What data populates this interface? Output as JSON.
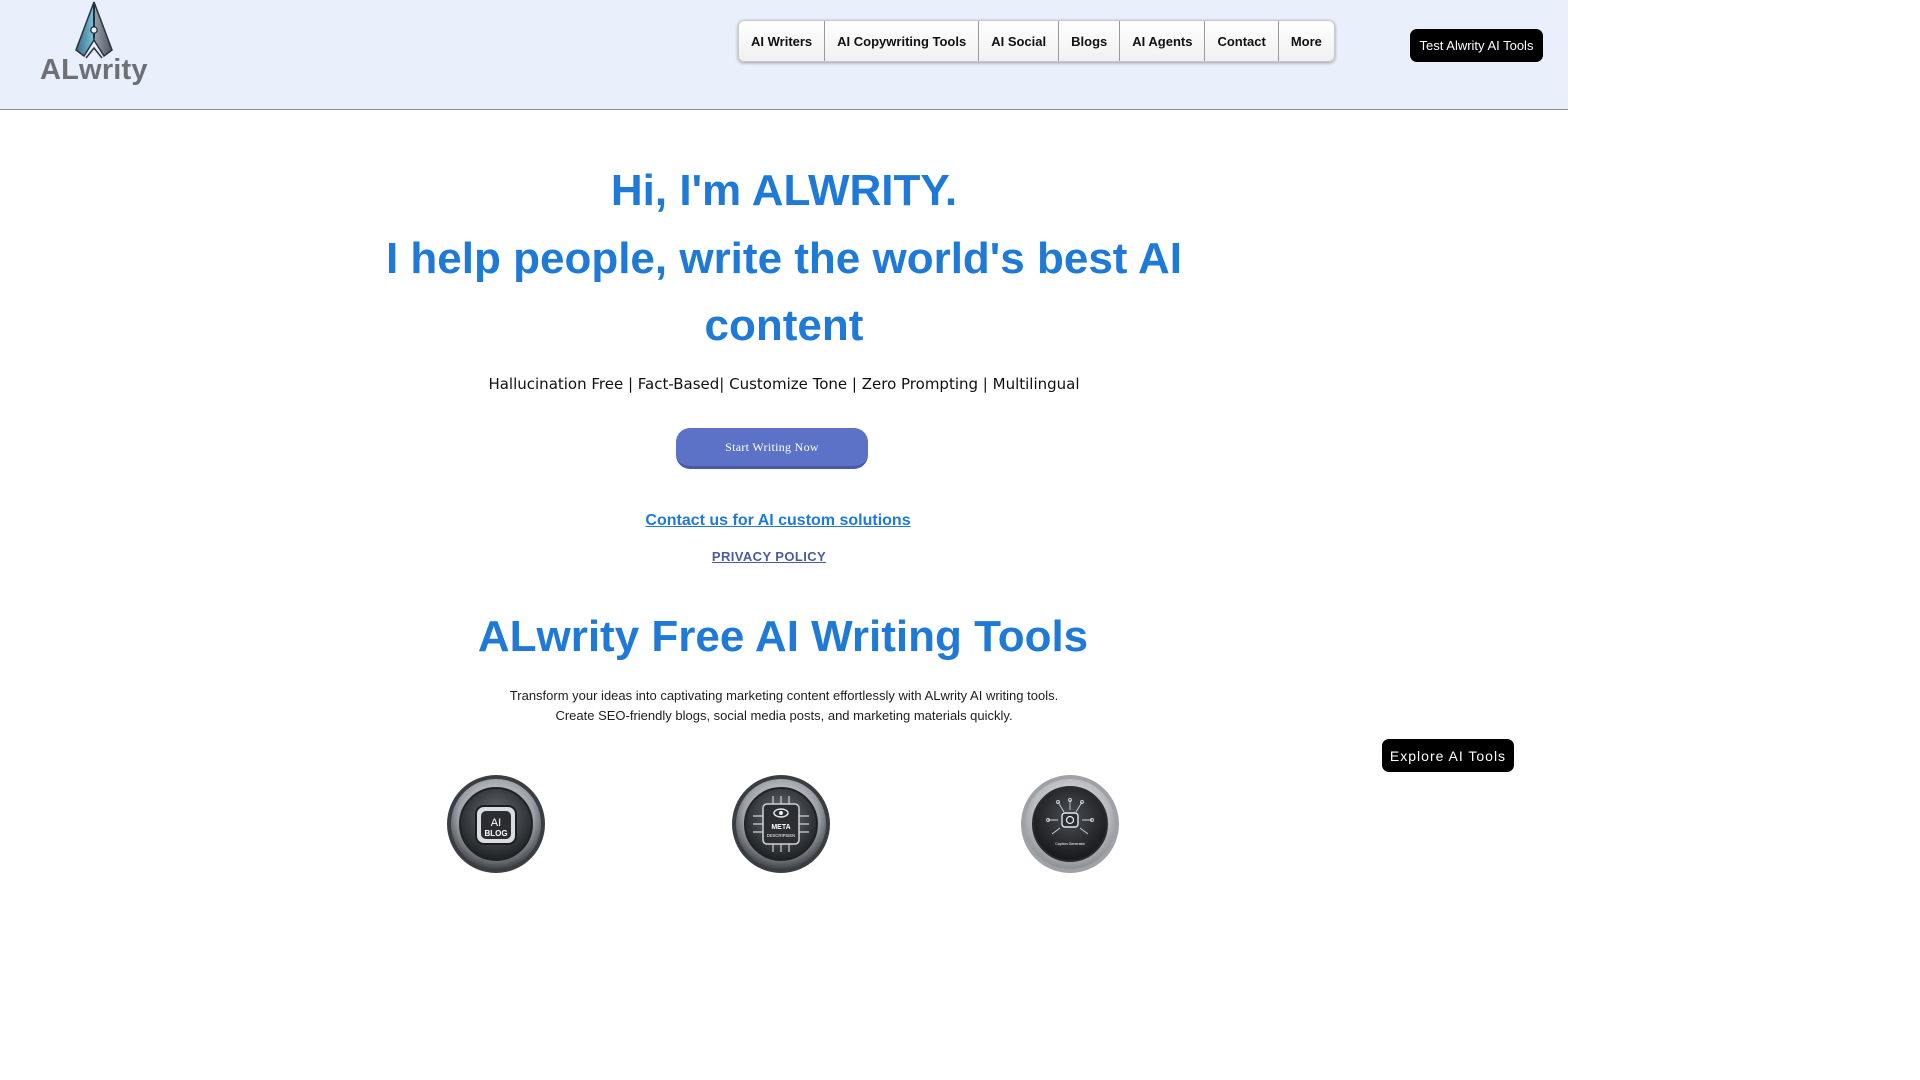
{
  "header": {
    "logo_text": "ALwrity",
    "nav": [
      {
        "label": "AI Writers"
      },
      {
        "label": "AI Copywriting Tools"
      },
      {
        "label": "AI Social"
      },
      {
        "label": "Blogs"
      },
      {
        "label": "AI Agents"
      },
      {
        "label": "Contact"
      },
      {
        "label": "More"
      }
    ],
    "cta_label": "Test Alwrity AI Tools"
  },
  "hero": {
    "line1": "Hi, I'm ALWRITY.",
    "line2": "I help people, write the world's best AI",
    "line3": "content",
    "features": "Hallucination Free | Fact-Based| Customize Tone | Zero Prompting | Multilingual",
    "start_button": "Start Writing Now",
    "contact_link": "Contact us for AI custom solutions",
    "privacy_link": "PRIVACY POLICY"
  },
  "tools": {
    "title": "ALwrity Free AI Writing Tools",
    "desc_line1": "Transform your ideas into captivating marketing content effortlessly with ALwrity AI writing tools.",
    "desc_line2": "Create SEO-friendly blogs, social media posts, and marketing materials quickly.",
    "icons": [
      {
        "name": "ai-blog-icon",
        "label_top": "AI",
        "label_bottom": "BLOG"
      },
      {
        "name": "meta-description-icon",
        "label_top": "META",
        "label_bottom": "DESCRIPSIEN"
      },
      {
        "name": "caption-generator-icon",
        "label": "Caption Generator"
      }
    ],
    "explore_button": "Explore AI Tools"
  },
  "colors": {
    "header_bg": "#e9f0fb",
    "accent_blue": "#1f79d6",
    "button_blue": "#5b72c7",
    "privacy_link": "#4a5c9c",
    "dark_button": "#000000"
  }
}
